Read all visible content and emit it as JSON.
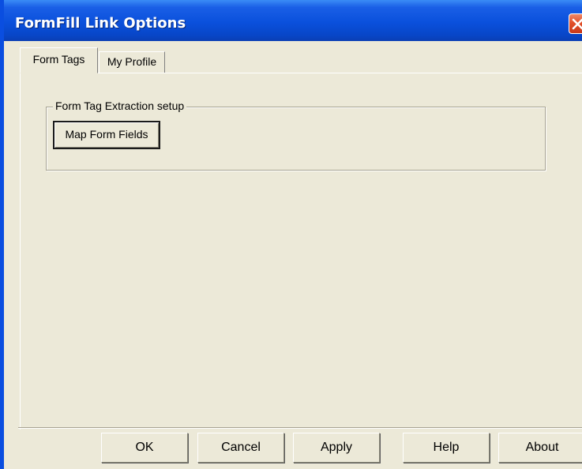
{
  "window": {
    "title": "FormFill Link Options",
    "close_icon": "close-icon"
  },
  "tabs": [
    {
      "label": "Form Tags",
      "active": true
    },
    {
      "label": "My Profile",
      "active": false
    }
  ],
  "form_tags": {
    "group_label": "Form Tag Extraction setup",
    "map_button_label": "Map Form Fields"
  },
  "buttons": {
    "ok": "OK",
    "cancel": "Cancel",
    "apply": "Apply",
    "help": "Help",
    "about": "About"
  },
  "colors": {
    "titlebar": "#0a50dc",
    "dialog_bg": "#ece9d8",
    "close_button": "#e2502a"
  }
}
